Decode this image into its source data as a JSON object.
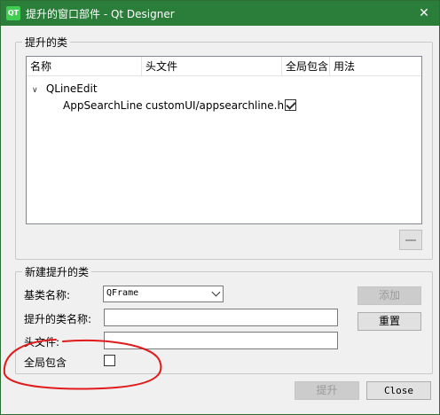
{
  "window": {
    "title": "提升的窗口部件 - Qt Designer",
    "app_icon_text": "QT",
    "close_glyph": "✕"
  },
  "promoted_group": {
    "title": "提升的类",
    "columns": [
      "名称",
      "头文件",
      "全局包含",
      "用法"
    ],
    "tree_parent": "QLineEdit",
    "rows": [
      {
        "name": "AppSearchLine",
        "header": "customUI/appsearchline.h",
        "global_include": true,
        "usage": ""
      }
    ],
    "remove_button_icon": "minus-icon"
  },
  "new_group": {
    "title": "新建提升的类",
    "base_class_label": "基类名称:",
    "base_class_value": "QFrame",
    "promoted_class_label": "提升的类名称:",
    "promoted_class_value": "",
    "header_file_label": "头文件:",
    "header_file_value": "",
    "global_include_label": "全局包含",
    "global_include_checked": false,
    "add_button": "添加",
    "reset_button": "重置"
  },
  "footer": {
    "promote_button": "提升",
    "close_button": "Close"
  },
  "annotation": {
    "color": "#e11b1b"
  }
}
